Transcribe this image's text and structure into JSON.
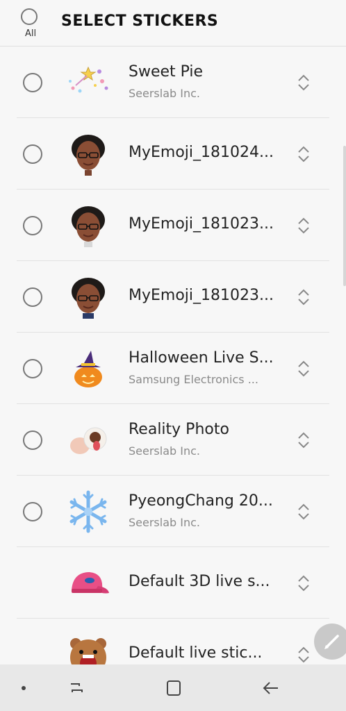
{
  "header": {
    "all_label": "All",
    "title": "SELECT STICKERS"
  },
  "stickers": [
    {
      "name": "Sweet Pie",
      "publisher": "Seerslab Inc.",
      "thumb": "sparkle-wand-icon"
    },
    {
      "name": "MyEmoji_181024...",
      "publisher": "",
      "thumb": "avatar-emoji"
    },
    {
      "name": "MyEmoji_181023...",
      "publisher": "",
      "thumb": "avatar-emoji"
    },
    {
      "name": "MyEmoji_181023...",
      "publisher": "",
      "thumb": "avatar-emoji"
    },
    {
      "name": "Halloween Live S...",
      "publisher": "Samsung Electronics ...",
      "thumb": "pumpkin-witch-hat-icon"
    },
    {
      "name": "Reality Photo",
      "publisher": "Seerslab Inc.",
      "thumb": "reality-photo-icon"
    },
    {
      "name": "PyeongChang 20...",
      "publisher": "Seerslab Inc.",
      "thumb": "snowflake-icon"
    },
    {
      "name": "Default 3D live s...",
      "publisher": "",
      "thumb": "pink-cap-icon"
    },
    {
      "name": "Default live stic...",
      "publisher": "",
      "thumb": "bear-icon"
    }
  ],
  "nav": {
    "items": [
      "recents-button",
      "home-button",
      "back-button"
    ]
  },
  "colors": {
    "background": "#f7f7f7",
    "divider": "#e2e2e2",
    "nav_bg": "#e8e8e8"
  }
}
